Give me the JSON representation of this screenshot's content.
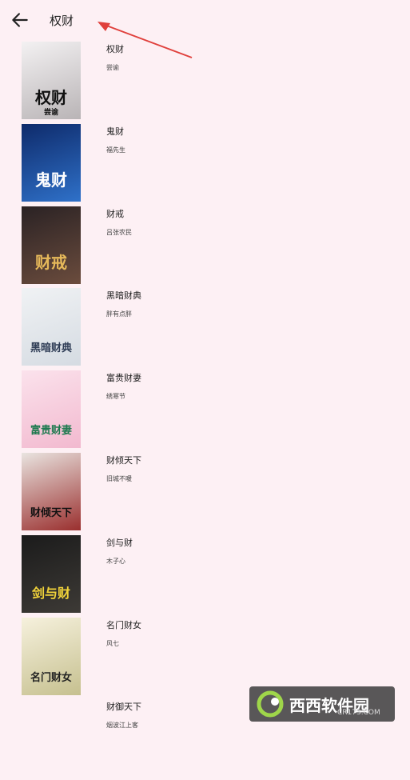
{
  "header": {
    "title": "权财"
  },
  "books": [
    {
      "title": "权财",
      "author": "尝谕",
      "cover_text": "权财",
      "cover_sub": "尝谕",
      "cover_colors": [
        "#f3f1f2",
        "#b9b4b6"
      ],
      "text_color": "#111111"
    },
    {
      "title": "鬼财",
      "author": "福先生",
      "cover_text": "鬼财",
      "cover_sub": "",
      "cover_colors": [
        "#0e2a6a",
        "#2f71c9"
      ],
      "text_color": "#ffffff"
    },
    {
      "title": "财戒",
      "author": "吕张农民",
      "cover_text": "财戒",
      "cover_sub": "",
      "cover_colors": [
        "#2a2224",
        "#6b4c3d"
      ],
      "text_color": "#e6b95a"
    },
    {
      "title": "黑暗财典",
      "author": "胖有点胖",
      "cover_text": "黑暗财典",
      "cover_sub": "",
      "cover_colors": [
        "#f0f2f4",
        "#d5dbe2"
      ],
      "text_color": "#2f3d56"
    },
    {
      "title": "富贵财妻",
      "author": "绣寒节",
      "cover_text": "富贵财妻",
      "cover_sub": "",
      "cover_colors": [
        "#fbe2ec",
        "#f2b9cf"
      ],
      "text_color": "#1e7a4f"
    },
    {
      "title": "财倾天下",
      "author": "旧城不暖",
      "cover_text": "财倾天下",
      "cover_sub": "",
      "cover_colors": [
        "#e9e4e0",
        "#9a2f2e"
      ],
      "text_color": "#111111"
    },
    {
      "title": "剑与财",
      "author": "木子心",
      "cover_text": "剑与财",
      "cover_sub": "",
      "cover_colors": [
        "#1b1b1b",
        "#3d3a36"
      ],
      "text_color": "#f1d33a"
    },
    {
      "title": "名门财女",
      "author": "风七",
      "cover_text": "名门财女",
      "cover_sub": "",
      "cover_colors": [
        "#f6f1dd",
        "#c6c08f"
      ],
      "text_color": "#222222"
    },
    {
      "title": "财御天下",
      "author": "烟波江上客",
      "cover_text": "",
      "cover_sub": "",
      "cover_colors": [
        "#fdf0f4",
        "#fdf0f4"
      ],
      "text_color": "#222222"
    }
  ],
  "watermark": {
    "text": "西西软件园",
    "sub": "CR173.COM"
  }
}
